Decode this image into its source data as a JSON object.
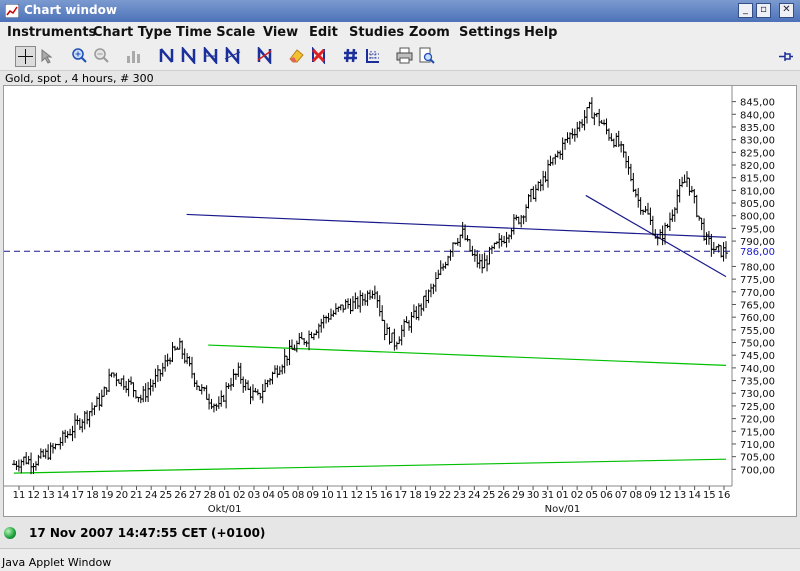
{
  "window": {
    "title": "Chart window"
  },
  "menu": [
    "Instruments",
    "Chart Type",
    "Time Scale",
    "View",
    "Edit",
    "Studies",
    "Zoom",
    "Settings",
    "Help"
  ],
  "toolbar_icons": [
    "crosshair-icon",
    "cursor-icon",
    "zoom-in-icon",
    "zoom-out-icon",
    "bar-chart-icon",
    "trend-line-icon",
    "parallel-lines-icon",
    "channel-icon",
    "fan-lines-icon",
    "fibonacci-icon",
    "eraser-icon",
    "delete-icon",
    "grid-icon",
    "dotted-grid-icon",
    "print-icon",
    "print-preview-icon",
    "pin-icon"
  ],
  "chart_info": "Gold, spot , 4 hours, # 300",
  "chart_data": {
    "type": "bar",
    "instrument": "Gold, spot",
    "timeframe": "4 hours",
    "ylim": [
      695,
      848
    ],
    "y_ticks": [
      "845,00",
      "840,00",
      "835,00",
      "830,00",
      "825,00",
      "820,00",
      "815,00",
      "810,00",
      "805,00",
      "800,00",
      "795,00",
      "790,00",
      "786,00",
      "780,00",
      "775,00",
      "770,00",
      "765,00",
      "760,00",
      "755,00",
      "750,00",
      "745,00",
      "740,00",
      "735,00",
      "730,00",
      "725,00",
      "720,00",
      "715,00",
      "710,00",
      "705,00",
      "700,00"
    ],
    "x_ticks": [
      "11",
      "12",
      "13",
      "14",
      "17",
      "18",
      "19",
      "20",
      "21",
      "24",
      "25",
      "26",
      "27",
      "28",
      "01",
      "02",
      "03",
      "04",
      "05",
      "08",
      "09",
      "10",
      "11",
      "12",
      "15",
      "16",
      "17",
      "18",
      "19",
      "22",
      "23",
      "24",
      "25",
      "26",
      "29",
      "30",
      "31",
      "01",
      "02",
      "05",
      "06",
      "07",
      "08",
      "09",
      "12",
      "13",
      "14",
      "15",
      "16"
    ],
    "month_labels": [
      {
        "label": "Okt/01",
        "index": 14
      },
      {
        "label": "Nov/01",
        "index": 37
      }
    ],
    "last_price": 786,
    "last_price_label": "786,00",
    "series_closes": [
      702,
      704,
      703,
      705,
      708,
      712,
      716,
      720,
      724,
      728,
      738,
      735,
      733,
      728,
      733,
      738,
      745,
      748,
      740,
      732,
      728,
      724,
      734,
      738,
      731,
      728,
      735,
      740,
      745,
      749,
      752,
      756,
      760,
      762,
      765,
      765,
      768,
      772,
      755,
      750,
      756,
      760,
      766,
      772,
      780,
      790,
      793,
      784,
      780,
      786,
      790,
      796,
      800,
      808,
      812,
      820,
      826,
      832,
      836,
      842,
      838,
      832,
      828,
      818,
      806,
      800,
      790,
      796,
      808,
      815,
      802,
      790,
      786,
      786
    ],
    "trendlines": [
      {
        "color": "#1a1a8c",
        "from": {
          "bar": 16,
          "y": 800.5
        },
        "to": {
          "bar": 66,
          "y": 791.5
        }
      },
      {
        "color": "#1a1a8c",
        "from": {
          "bar": 53,
          "y": 808
        },
        "to": {
          "bar": 66,
          "y": 776
        }
      },
      {
        "color": "#00c000",
        "from": {
          "bar": 18,
          "y": 749
        },
        "to": {
          "bar": 66,
          "y": 741
        }
      },
      {
        "color": "#00c000",
        "from": {
          "bar": 0,
          "y": 698.5
        },
        "to": {
          "bar": 66,
          "y": 704
        }
      }
    ]
  },
  "status": {
    "datetime": "17 Nov 2007 14:47:55  CET (+0100)"
  },
  "applet_label": "Java Applet Window"
}
